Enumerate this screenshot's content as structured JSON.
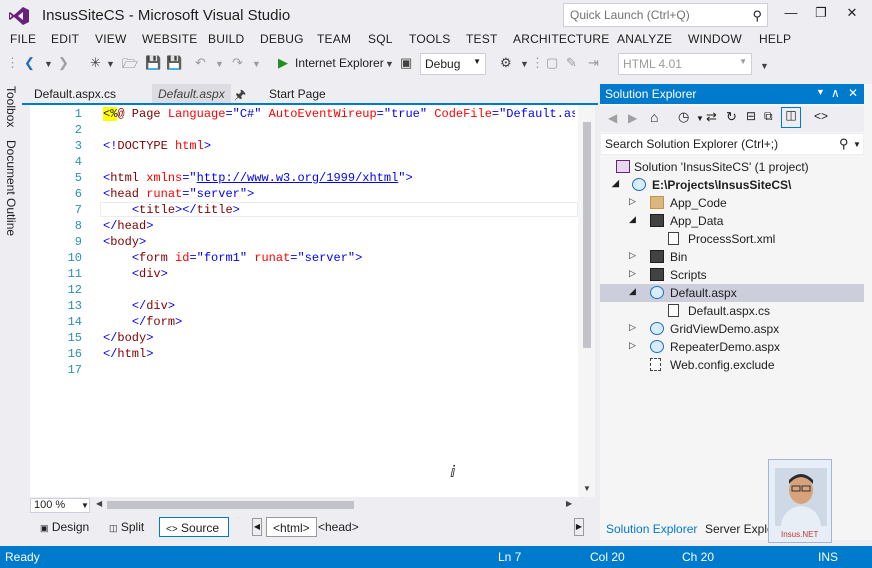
{
  "window": {
    "title": "InsusSiteCS - Microsoft Visual Studio",
    "quick_launch_placeholder": "Quick Launch (Ctrl+Q)",
    "minimize": "—",
    "restore": "❐",
    "close": "✕"
  },
  "menu": [
    "FILE",
    "EDIT",
    "VIEW",
    "WEBSITE",
    "BUILD",
    "DEBUG",
    "TEAM",
    "SQL",
    "TOOLS",
    "TEST",
    "ARCHITECTURE",
    "ANALYZE",
    "WINDOW",
    "HELP"
  ],
  "toolbar": {
    "run_label": "Internet Explorer",
    "config": "Debug",
    "html_version": "HTML 4.01"
  },
  "left_tool_tabs": [
    "Toolbox",
    "Document Outline"
  ],
  "doc_tabs": [
    {
      "label": "Default.aspx.cs",
      "active": false
    },
    {
      "label": "Default.aspx",
      "active": true
    },
    {
      "label": "Start Page",
      "active": false
    }
  ],
  "editor": {
    "line_numbers": [
      "1",
      "2",
      "3",
      "4",
      "5",
      "6",
      "7",
      "8",
      "9",
      "10",
      "11",
      "12",
      "13",
      "14",
      "15",
      "16",
      "17"
    ],
    "lines": {
      "l1": {
        "hl": "<%",
        "rest1": "@ Page ",
        "a1": "Language",
        "eq1": "=",
        "v1": "\"C#\"",
        "a2": " AutoEventWireup",
        "eq2": "=",
        "v2": "\"true\"",
        "a3": " CodeFile",
        "eq3": "=",
        "v3": "\"Default.aspx"
      },
      "l3": {
        "lt": "<!",
        "tag": "DOCTYPE",
        "attr": " html",
        "gt": ">"
      },
      "l5": {
        "lt": "<",
        "tag": "html",
        "attr": " xmlns",
        "eq": "=\"",
        "url": "http://www.w3.org/1999/xhtml",
        "end": "\">"
      },
      "l6": {
        "lt": "<",
        "tag": "head",
        "attr": " runat",
        "eq": "=",
        "val": "\"server\"",
        "gt": ">"
      },
      "l7": {
        "indent": "    ",
        "o1": "<",
        "t1": "title",
        "c1": "></",
        "t2": "title",
        "c2": ">"
      },
      "l8": {
        "lt": "</",
        "tag": "head",
        "gt": ">"
      },
      "l9": {
        "lt": "<",
        "tag": "body",
        "gt": ">"
      },
      "l10": {
        "indent": "    ",
        "lt": "<",
        "tag": "form",
        "a1": " id",
        "eq1": "=",
        "v1": "\"form1\"",
        "a2": " runat",
        "eq2": "=",
        "v2": "\"server\"",
        "gt": ">"
      },
      "l11": {
        "indent": "    ",
        "lt": "<",
        "tag": "div",
        "gt": ">"
      },
      "l13": {
        "indent": "    ",
        "lt": "</",
        "tag": "div",
        "gt": ">"
      },
      "l14": {
        "indent": "    ",
        "lt": "</",
        "tag": "form",
        "gt": ">"
      },
      "l15": {
        "lt": "</",
        "tag": "body",
        "gt": ">"
      },
      "l16": {
        "lt": "</",
        "tag": "html",
        "gt": ">"
      }
    }
  },
  "zoom": "100 %",
  "view_modes": {
    "design": "Design",
    "split": "Split",
    "source": "Source"
  },
  "breadcrumbs": [
    "<html>",
    "<head>"
  ],
  "solution_explorer": {
    "title": "Solution Explorer",
    "search_placeholder": "Search Solution Explorer (Ctrl+;)",
    "tree": [
      {
        "label": "Solution 'InsusSiteCS' (1 project)",
        "icon": "solution-icon",
        "level": 0,
        "expander": "none",
        "selected": false
      },
      {
        "label": "E:\\Projects\\InsusSiteCS\\",
        "icon": "globe-icon",
        "level": 1,
        "expander": "expanded",
        "selected": false
      },
      {
        "label": "App_Code",
        "icon": "folder-icon",
        "level": 2,
        "expander": "collapsed",
        "selected": false
      },
      {
        "label": "App_Data",
        "icon": "folder-icon",
        "level": 2,
        "expander": "expanded",
        "selected": false
      },
      {
        "label": "ProcessSort.xml",
        "icon": "file-icon",
        "level": 3,
        "expander": "none",
        "selected": false
      },
      {
        "label": "Bin",
        "icon": "folder-icon",
        "level": 2,
        "expander": "collapsed",
        "selected": false
      },
      {
        "label": "Scripts",
        "icon": "folder-icon",
        "level": 2,
        "expander": "collapsed",
        "selected": false
      },
      {
        "label": "Default.aspx",
        "icon": "web-page-icon",
        "level": 2,
        "expander": "expanded",
        "selected": true
      },
      {
        "label": "Default.aspx.cs",
        "icon": "cs-file-icon",
        "level": 3,
        "expander": "none",
        "selected": false
      },
      {
        "label": "GridViewDemo.aspx",
        "icon": "web-page-icon",
        "level": 2,
        "expander": "collapsed",
        "selected": false
      },
      {
        "label": "RepeaterDemo.aspx",
        "icon": "web-page-icon",
        "level": 2,
        "expander": "collapsed",
        "selected": false
      },
      {
        "label": "Web.config.exclude",
        "icon": "file-icon",
        "level": 2,
        "expander": "none",
        "selected": false
      }
    ],
    "bottom_tabs": [
      "Solution Explorer",
      "Server Explorer"
    ]
  },
  "avatar_caption": "Insus.NET",
  "status": {
    "left": "Ready",
    "ln": "Ln 7",
    "col": "Col 20",
    "ch": "Ch 20",
    "mode": "INS"
  },
  "colors": {
    "accent": "#007acc",
    "line_number": "#2b91af",
    "tag": "#800000",
    "attribute": "#ff0000",
    "value": "#0000ff"
  }
}
